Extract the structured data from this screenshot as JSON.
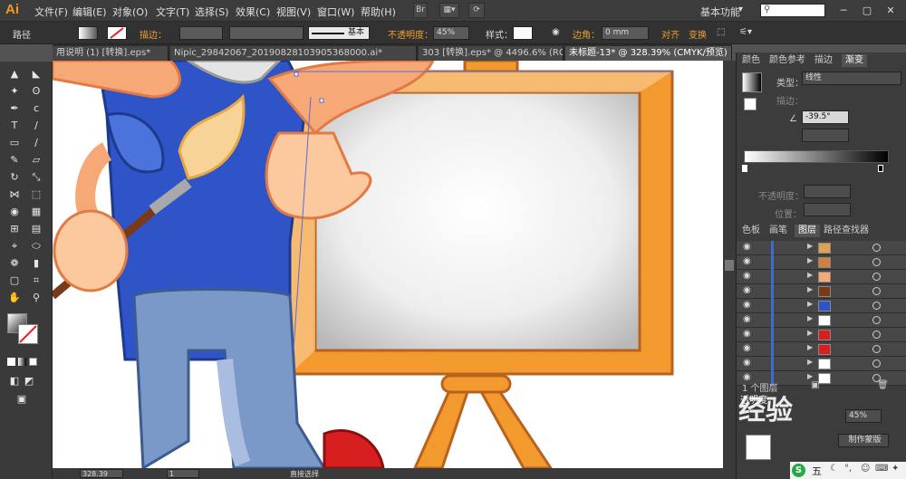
{
  "app": {
    "logo": "Ai",
    "workspace": "基本功能"
  },
  "menu": [
    "文件(F)",
    "编辑(E)",
    "对象(O)",
    "文字(T)",
    "选择(S)",
    "效果(C)",
    "视图(V)",
    "窗口(W)",
    "帮助(H)"
  ],
  "menubar_btn": "Br",
  "control": {
    "path_label": "路径",
    "stroke_label": "描边：",
    "brush_label": "基本",
    "opacity_label": "不透明度：",
    "opacity_value": "45%",
    "style_label": "样式：",
    "corner_label": "边角：",
    "corner_value": "0 mm",
    "align_label": "对齐",
    "transform_label": "变换"
  },
  "tabs": [
    "用说明 (1) [转换].eps*",
    "Nipic_29842067_20190828103905368000.ai*",
    "303 [转换].eps* @ 4496.6% (RG...",
    "未标题-13* @ 328.39% (CMYK/预览)"
  ],
  "tools": [
    [
      "selection-tool",
      "▲"
    ],
    [
      "direct-selection-tool",
      "◣"
    ],
    [
      "magic-wand-tool",
      "✦"
    ],
    [
      "lasso-tool",
      "ʘ"
    ],
    [
      "pen-tool",
      "✒"
    ],
    [
      "curvature-tool",
      "ⅽ"
    ],
    [
      "type-tool",
      "T"
    ],
    [
      "line-tool",
      "∕"
    ],
    [
      "rectangle-tool",
      "▭"
    ],
    [
      "paintbrush-tool",
      "∕"
    ],
    [
      "pencil-tool",
      "✎"
    ],
    [
      "eraser-tool",
      "▱"
    ],
    [
      "rotate-tool",
      "↻"
    ],
    [
      "scale-tool",
      "⤡"
    ],
    [
      "width-tool",
      "⋈"
    ],
    [
      "free-transform-tool",
      "⬚"
    ],
    [
      "shape-builder-tool",
      "◉"
    ],
    [
      "perspective-grid-tool",
      "▦"
    ],
    [
      "mesh-tool",
      "⊞"
    ],
    [
      "gradient-tool",
      "▤"
    ],
    [
      "eyedropper-tool",
      "⌖"
    ],
    [
      "blend-tool",
      "⬭"
    ],
    [
      "symbol-sprayer-tool",
      "❁"
    ],
    [
      "column-graph-tool",
      "▮"
    ],
    [
      "artboard-tool",
      "▢"
    ],
    [
      "slice-tool",
      "⌗"
    ],
    [
      "hand-tool",
      "✋"
    ],
    [
      "zoom-tool",
      "⚲"
    ]
  ],
  "gradient_panel": {
    "tabs": [
      "颜色",
      "颜色参考",
      "描边",
      "渐变"
    ],
    "type_label": "类型：",
    "type_value": "线性",
    "stroke_label": "描边：",
    "angle_value": "-39.5°",
    "opacity_label": "不透明度：",
    "location_label": "位置："
  },
  "layers_panel": {
    "tabs": [
      "色板",
      "画笔",
      "图层",
      "路径查找器"
    ],
    "row_count": 10,
    "footer_label": "1 个图层"
  },
  "align_panel": {
    "title": "透明度",
    "value": "45%",
    "button": "制作蒙版"
  },
  "status": {
    "zoom": "328.39",
    "page": "1",
    "tool": "直接选择"
  },
  "watermark": "经验",
  "taskbar": {
    "ime": "五"
  },
  "colors": {
    "accent": "#f0a030",
    "frame_orange": "#f29a2e",
    "shirt_blue": "#2e54c8",
    "pants_blue": "#7a99c8"
  }
}
